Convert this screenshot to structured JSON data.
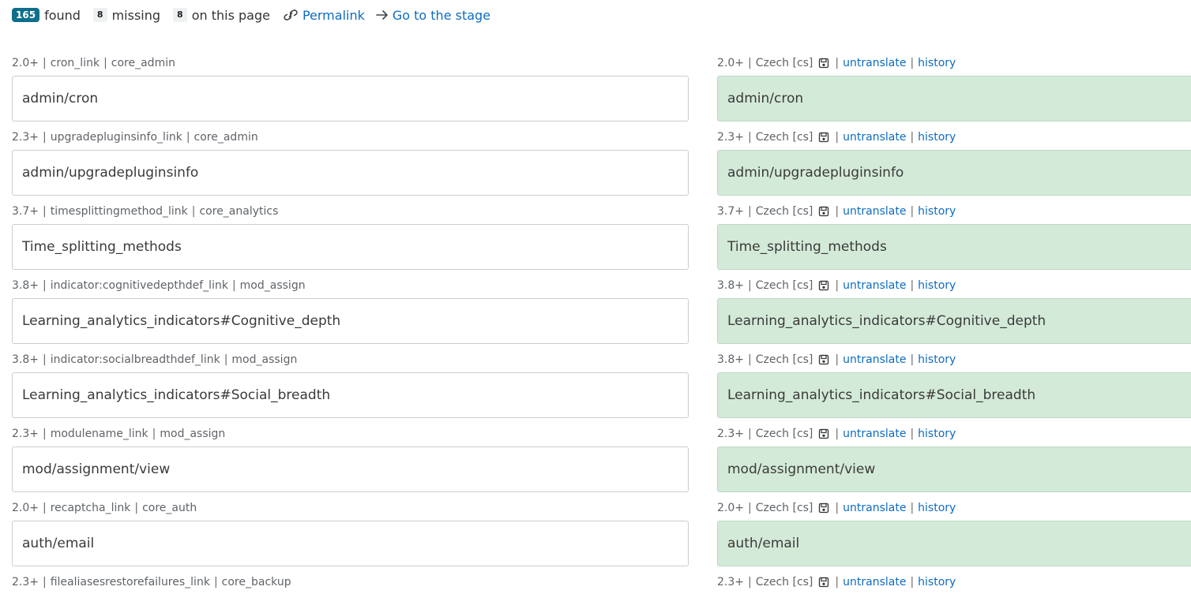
{
  "stats": {
    "found_count": "165",
    "found_label": "found",
    "missing_count": "8",
    "missing_label": "missing",
    "page_count": "8",
    "page_label": "on this page",
    "permalink_label": "Permalink",
    "stage_label": "Go to the stage"
  },
  "lang": "Czech [cs]",
  "untranslate_label": "untranslate",
  "history_label": "history",
  "rows": [
    {
      "version": "2.0+",
      "key": "cron_link",
      "component": "core_admin",
      "source": "admin/cron",
      "translation": "admin/cron"
    },
    {
      "version": "2.3+",
      "key": "upgradepluginsinfo_link",
      "component": "core_admin",
      "source": "admin/upgradepluginsinfo",
      "translation": "admin/upgradepluginsinfo"
    },
    {
      "version": "3.7+",
      "key": "timesplittingmethod_link",
      "component": "core_analytics",
      "source": "Time_splitting_methods",
      "translation": "Time_splitting_methods"
    },
    {
      "version": "3.8+",
      "key": "indicator:cognitivedepthdef_link",
      "component": "mod_assign",
      "source": "Learning_analytics_indicators#Cognitive_depth",
      "translation": "Learning_analytics_indicators#Cognitive_depth"
    },
    {
      "version": "3.8+",
      "key": "indicator:socialbreadthdef_link",
      "component": "mod_assign",
      "source": "Learning_analytics_indicators#Social_breadth",
      "translation": "Learning_analytics_indicators#Social_breadth"
    },
    {
      "version": "2.3+",
      "key": "modulename_link",
      "component": "mod_assign",
      "source": "mod/assignment/view",
      "translation": "mod/assignment/view"
    },
    {
      "version": "2.0+",
      "key": "recaptcha_link",
      "component": "core_auth",
      "source": "auth/email",
      "translation": "auth/email"
    },
    {
      "version": "2.3+",
      "key": "filealiasesrestorefailures_link",
      "component": "core_backup"
    }
  ],
  "icons": {
    "permalink": "link-icon",
    "stage": "arrow-right-icon",
    "save": "floppy-disk-icon"
  }
}
